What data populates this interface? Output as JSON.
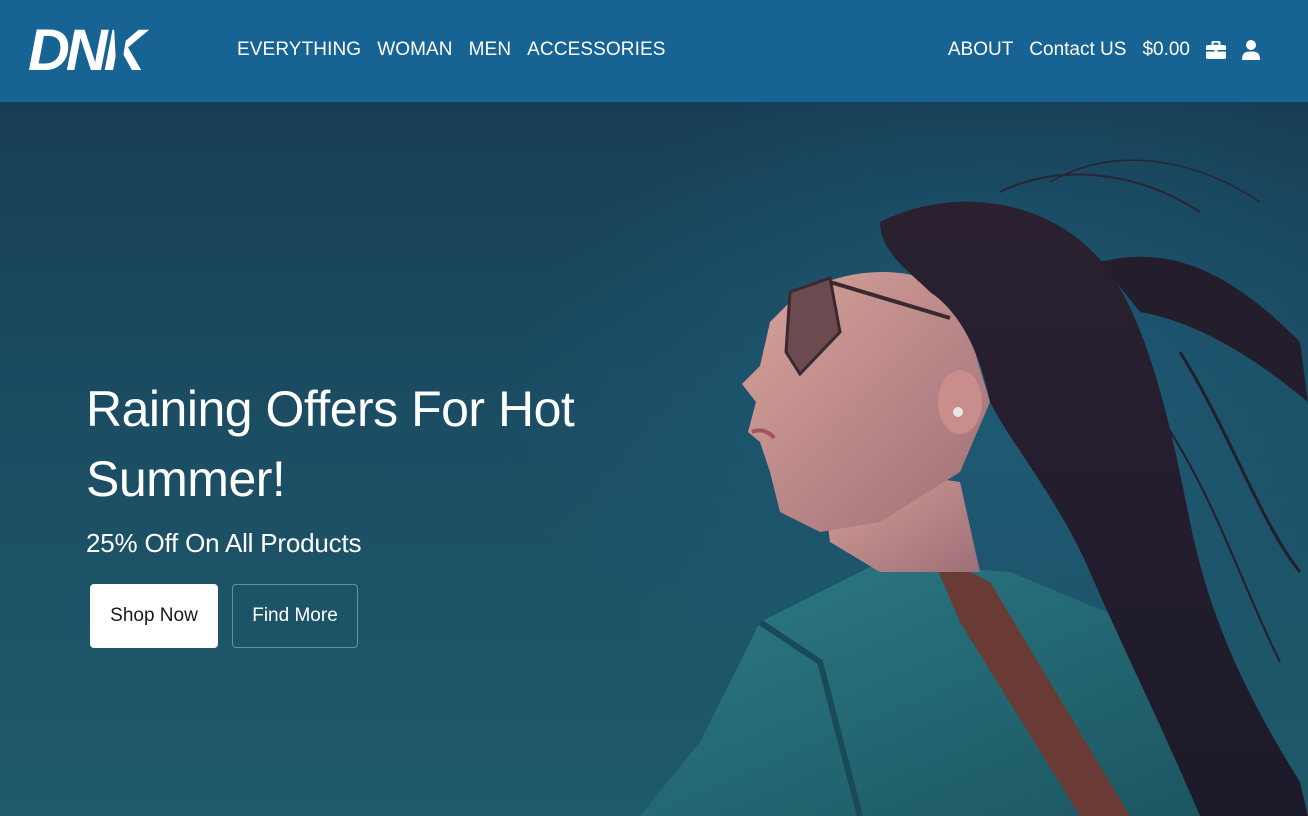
{
  "brand": {
    "logo_text": "DNK"
  },
  "nav": {
    "left": [
      "EVERYTHING",
      "WOMAN",
      "MEN",
      "ACCESSORIES"
    ],
    "about": "ABOUT",
    "contact": "Contact US",
    "cart_total": "$0.00",
    "icons": [
      "briefcase-icon",
      "user-icon"
    ]
  },
  "hero": {
    "title": "Raining Offers For Hot Summer!",
    "subtitle": "25% Off On All Products",
    "primary_button": "Shop Now",
    "secondary_button": "Find More"
  },
  "colors": {
    "header": "#176393",
    "hero_bg": "#18425a",
    "text": "#ffffff",
    "primary_button_bg": "#ffffff",
    "primary_button_text": "#1a1a1a"
  }
}
